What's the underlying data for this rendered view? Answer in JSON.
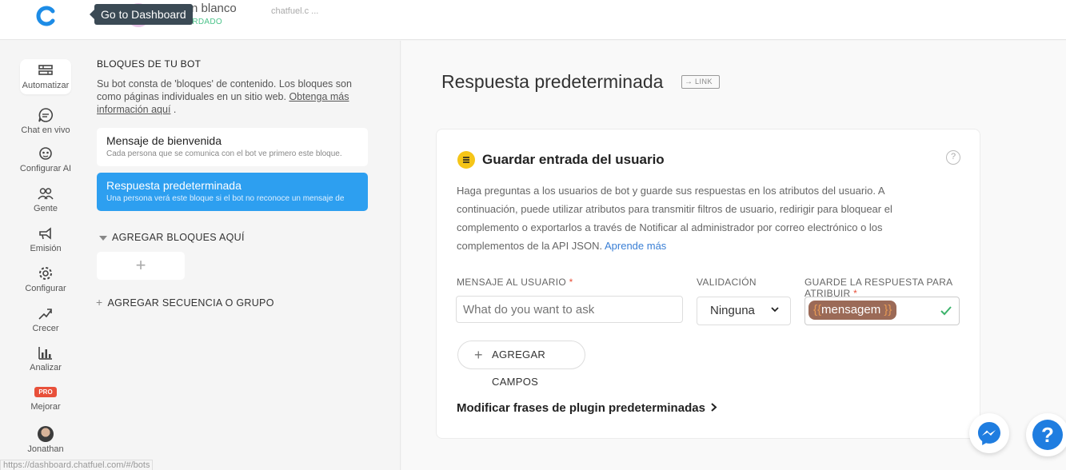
{
  "header": {
    "bot_name": "Bot en blanco",
    "bot_status": "✓ GUARDADO",
    "bot_url": "chatfuel.c ...",
    "tooltip": "Go to Dashboard"
  },
  "nav": {
    "items": [
      {
        "label": "Automatizar",
        "icon": "automate-icon"
      },
      {
        "label": "Chat en vivo",
        "icon": "chat-icon"
      },
      {
        "label": "Configurar AI",
        "icon": "ai-icon"
      },
      {
        "label": "Gente",
        "icon": "people-icon"
      },
      {
        "label": "Emisión",
        "icon": "megaphone-icon"
      },
      {
        "label": "Configurar",
        "icon": "gear-icon"
      },
      {
        "label": "Crecer",
        "icon": "growth-icon"
      },
      {
        "label": "Analizar",
        "icon": "chart-icon"
      },
      {
        "label": "Mejorar",
        "badge": "PRO"
      },
      {
        "label": "Jonathan",
        "icon": "avatar"
      }
    ]
  },
  "blocks": {
    "heading": "BLOQUES DE TU BOT",
    "desc_text": "Su bot consta de 'bloques' de contenido. Los bloques son como páginas individuales en un sitio web. ",
    "desc_link": "Obtenga más información aquí",
    "desc_end": " .",
    "cards": [
      {
        "title": "Mensaje de bienvenida",
        "sub": "Cada persona que se comunica con el bot ve primero este bloque."
      },
      {
        "title": "Respuesta predeterminada",
        "sub": "Una persona verá este bloque si el bot no reconoce un mensaje de"
      }
    ],
    "add_here": "AGREGAR BLOQUES AQUÍ",
    "plus": "+",
    "add_sequence": "AGREGAR SECUENCIA O GRUPO"
  },
  "status_url": "https://dashboard.chatfuel.com/#/bots",
  "main": {
    "title": "Respuesta predeterminada",
    "link_label": "LINK",
    "panel": {
      "title": "Guardar entrada del usuario",
      "help": "?",
      "description": "Haga preguntas a los usuarios de bot y guarde sus respuestas en los atributos del usuario. A continuación, puede utilizar atributos para transmitir filtros de usuario, redirigir para bloquear el complemento o exportarlos a través de Notificar al administrador por correo electrónico o los complementos de la API JSON. ",
      "learn_more": "Aprende más",
      "col_message": "MENSAJE AL USUARIO",
      "col_validation": "VALIDACIÓN",
      "col_attribute": "GUARDE LA RESPUESTA PARA ATRIBUIR",
      "required": "*",
      "message_placeholder": "What do you want to ask",
      "validation_value": "Ninguna",
      "attribute_open": "{{",
      "attribute_value": "mensagem",
      "attribute_close": "}}",
      "add_fields": "AGREGAR CAMPOS",
      "modify_link": "Modificar frases de plugin predeterminadas"
    }
  },
  "fab": {
    "help": "?"
  },
  "colors": {
    "accent": "#2d9ff0",
    "pro": "#e8503a",
    "chip": "#9b6a57",
    "icon_yellow": "#f5c518"
  }
}
